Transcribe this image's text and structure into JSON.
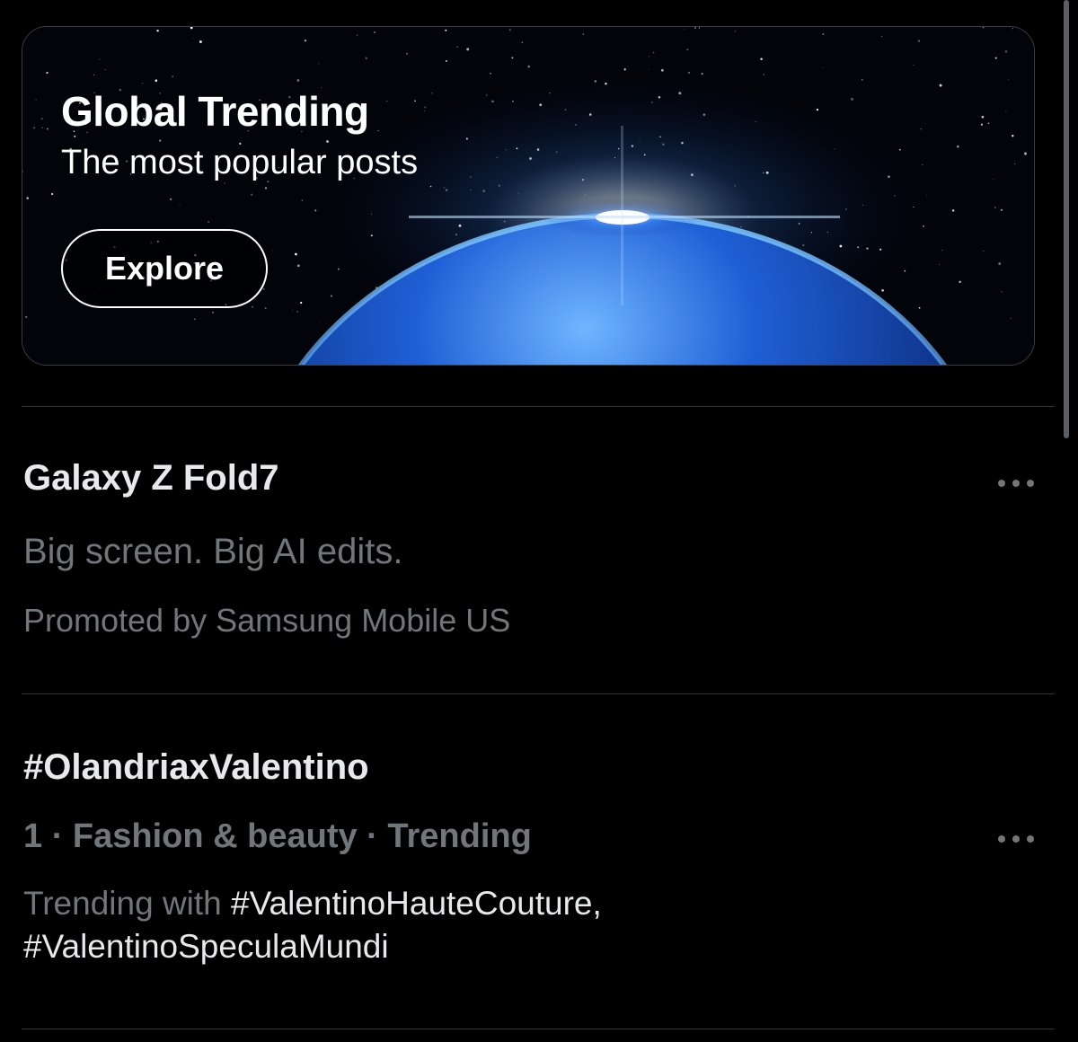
{
  "hero": {
    "title": "Global Trending",
    "subtitle": "The most popular posts",
    "button_label": "Explore"
  },
  "promoted": {
    "title": "Galaxy Z Fold7",
    "tagline": "Big screen. Big AI edits.",
    "byline": "Promoted by Samsung Mobile US",
    "more_icon": "more-horizontal-icon"
  },
  "trend": {
    "title": "#OlandriaxValentino",
    "meta": "1 · Fashion & beauty · Trending",
    "trending_with_label": "Trending with",
    "tag_1": "#ValentinoHauteCouture,",
    "tag_2": "#ValentinoSpeculaMundi",
    "more_icon": "more-horizontal-icon"
  },
  "colors": {
    "background": "#000000",
    "primary_text": "#e7e9ea",
    "secondary_text": "#71767b",
    "divider": "#2f3336"
  }
}
